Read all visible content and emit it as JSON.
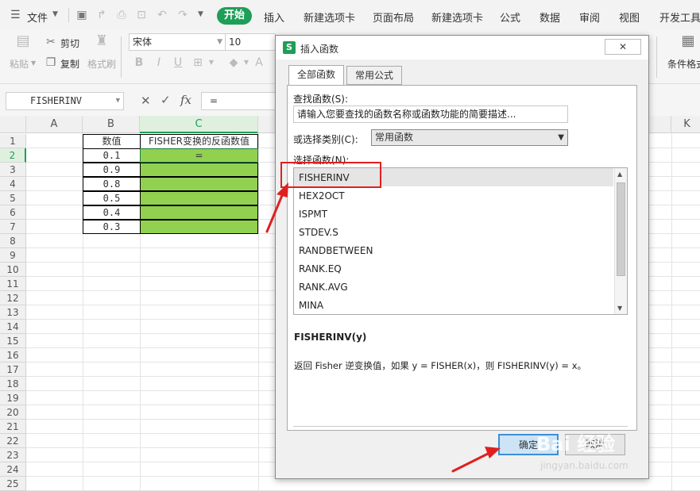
{
  "menubar": {
    "file_label": "文件",
    "tabs": [
      "开始",
      "插入",
      "新建选项卡",
      "页面布局",
      "新建选项卡",
      "公式",
      "数据",
      "审阅",
      "视图",
      "开发工具"
    ]
  },
  "ribbon": {
    "paste": "粘贴",
    "cut": "剪切",
    "copy": "复制",
    "format_painter": "格式刷",
    "font_name": "宋体",
    "font_size": "10",
    "conditional_format": "条件格式"
  },
  "formula_bar": {
    "name_box": "FISHERINV",
    "fx": "fx",
    "value": "="
  },
  "sheet": {
    "columns": [
      "A",
      "B",
      "C",
      "K"
    ],
    "rows": [
      "1",
      "2",
      "3",
      "4",
      "5",
      "6",
      "7",
      "8",
      "9",
      "10",
      "11",
      "12",
      "13",
      "14",
      "15",
      "16",
      "17",
      "18",
      "19",
      "20",
      "21",
      "22",
      "23",
      "24",
      "25"
    ],
    "header_b": "数值",
    "header_c": "FISHER变换的反函数值",
    "values": [
      "0.1",
      "0.9",
      "0.8",
      "0.5",
      "0.4",
      "0.3"
    ],
    "c2": "="
  },
  "dialog": {
    "title": "插入函数",
    "tab_all": "全部函数",
    "tab_common": "常用公式",
    "search_label": "查找函数(S):",
    "search_value": "请输入您要查找的函数名称或函数功能的简要描述...",
    "category_label": "或选择类别(C):",
    "category_value": "常用函数",
    "select_label": "选择函数(N):",
    "functions": [
      "FISHERINV",
      "HEX2OCT",
      "ISPMT",
      "STDEV.S",
      "RANDBETWEEN",
      "RANK.EQ",
      "RANK.AVG",
      "MINA"
    ],
    "signature": "FISHERINV(y)",
    "description": "返回 Fisher 逆变换值，如果 y = FISHER(x)，则 FISHERINV(y) = x。",
    "ok": "确定",
    "cancel": "取消"
  },
  "watermark": {
    "brand": "Bai 经验",
    "url": "jingyan.baidu.com"
  },
  "colors": {
    "accent": "#1e9e57",
    "cell_fill": "#92d050",
    "annotation": "#e02020"
  }
}
